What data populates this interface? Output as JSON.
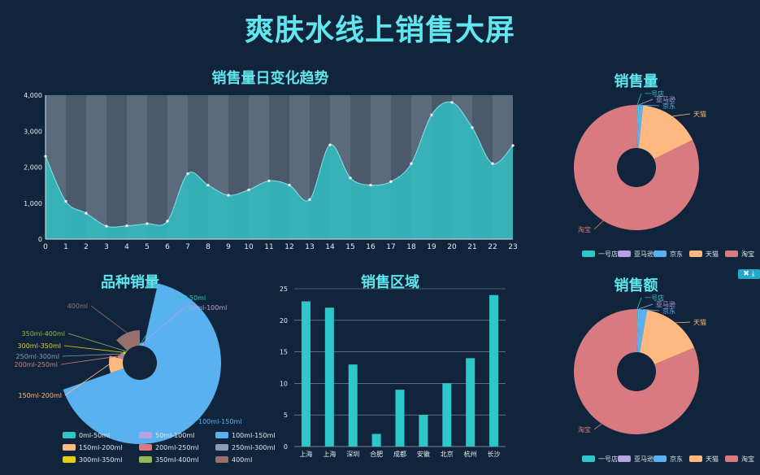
{
  "page_title": "爽肤水线上销售大屏",
  "toolbox_icons": [
    "close-icon",
    "download-icon"
  ],
  "chart_data": [
    {
      "id": "daily",
      "type": "area",
      "title": "销售量日变化趋势",
      "x": [
        "0",
        "1",
        "2",
        "3",
        "4",
        "5",
        "6",
        "7",
        "8",
        "9",
        "10",
        "11",
        "12",
        "13",
        "14",
        "15",
        "16",
        "17",
        "18",
        "19",
        "20",
        "21",
        "22",
        "23"
      ],
      "values": [
        2300,
        1050,
        720,
        360,
        370,
        430,
        500,
        1820,
        1500,
        1220,
        1370,
        1620,
        1500,
        1100,
        2620,
        1700,
        1500,
        1600,
        2100,
        3450,
        3800,
        3100,
        2100,
        2600
      ],
      "ylim": [
        0,
        4000
      ],
      "yticks": [
        "0",
        "1,000",
        "2,000",
        "3,000",
        "4,000"
      ],
      "color": "#2ec7c9"
    },
    {
      "id": "volume",
      "type": "pie",
      "title": "销售量",
      "labels": [
        "一号店",
        "亚马逊",
        "京东",
        "天猫",
        "淘宝"
      ],
      "values": [
        0.4,
        0.3,
        1.0,
        16,
        82
      ],
      "colors": [
        "#2ec7c9",
        "#b6a2de",
        "#5ab1ef",
        "#ffb980",
        "#d87a80"
      ],
      "legend": "bottom"
    },
    {
      "id": "amount",
      "type": "pie",
      "title": "销售额",
      "labels": [
        "一号店",
        "亚马逊",
        "京东",
        "天猫",
        "淘宝"
      ],
      "values": [
        0.4,
        0.3,
        2.0,
        16,
        81
      ],
      "colors": [
        "#2ec7c9",
        "#b6a2de",
        "#5ab1ef",
        "#ffb980",
        "#d87a80"
      ],
      "legend": "bottom"
    },
    {
      "id": "variety",
      "type": "pie",
      "title": "品种销量",
      "labels": [
        "0ml-50ml",
        "50ml-100ml",
        "100ml-150ml",
        "150ml-200ml",
        "200ml-250ml",
        "250ml-300ml",
        "300ml-350ml",
        "350ml-400ml",
        "400ml"
      ],
      "values": [
        2,
        2,
        60,
        5,
        1,
        1,
        1,
        1,
        6
      ],
      "colors": [
        "#2ec7c9",
        "#b6a2de",
        "#5ab1ef",
        "#ffb980",
        "#d87a80",
        "#8d98b3",
        "#e5cf0d",
        "#97b552",
        "#95706d"
      ],
      "legend": "bottom"
    },
    {
      "id": "region",
      "type": "bar",
      "title": "销售区域",
      "categories": [
        "上海",
        "上海",
        "深圳",
        "合肥",
        "成都",
        "安徽",
        "北京",
        "杭州",
        "长沙"
      ],
      "values": [
        23,
        22,
        13,
        2,
        9,
        5,
        10,
        14,
        24
      ],
      "ylim": [
        0,
        25
      ],
      "yticks": [
        "0",
        "5",
        "10",
        "15",
        "20",
        "25"
      ],
      "color": "#2ec7c9"
    }
  ]
}
